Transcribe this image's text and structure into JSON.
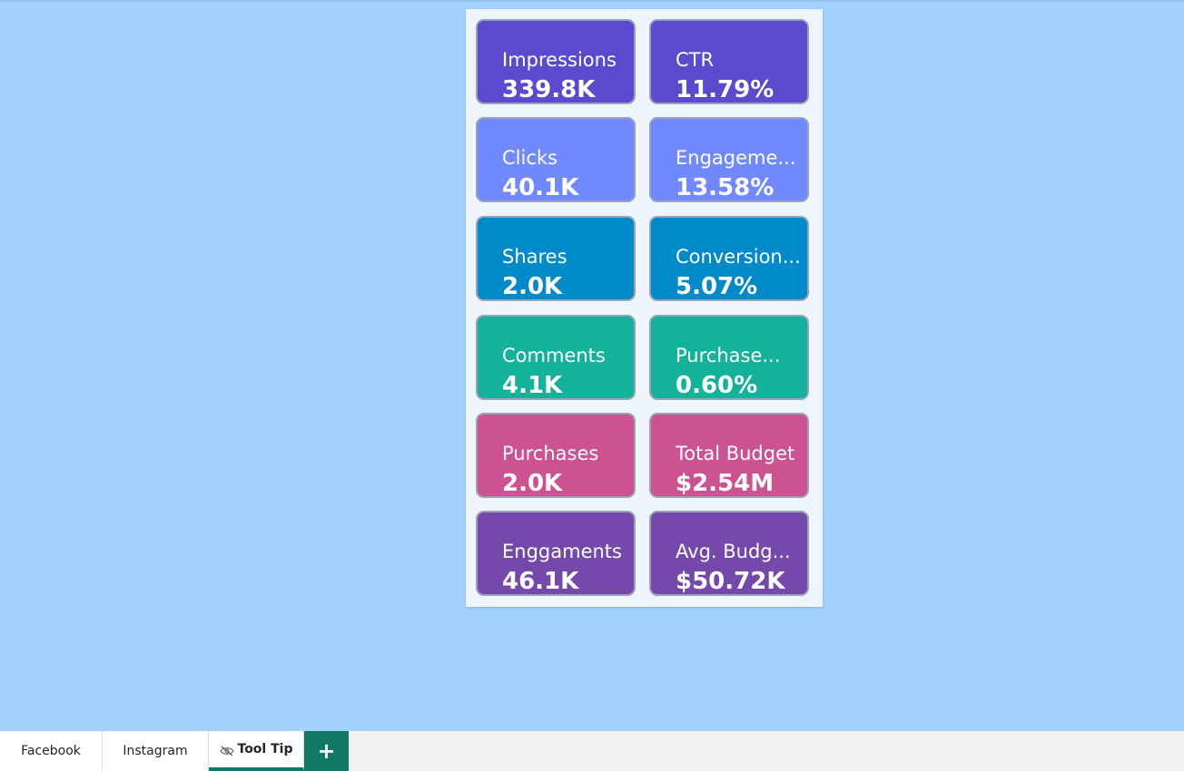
{
  "cards": [
    {
      "label": "Impressions",
      "value": "339.8K",
      "color": "#5a4bce"
    },
    {
      "label": "CTR",
      "value": "11.79%",
      "color": "#5a4bce"
    },
    {
      "label": "Clicks",
      "value": "40.1K",
      "color": "#7089fe"
    },
    {
      "label": "Engageme...",
      "value": "13.58%",
      "color": "#7089fe"
    },
    {
      "label": "Shares",
      "value": "2.0K",
      "color": "#018ac9"
    },
    {
      "label": "Conversion...",
      "value": "5.07%",
      "color": "#018ac9"
    },
    {
      "label": "Comments",
      "value": "4.1K",
      "color": "#13b29b"
    },
    {
      "label": "Purchase...",
      "value": "0.60%",
      "color": "#13b29b"
    },
    {
      "label": "Purchases",
      "value": "2.0K",
      "color": "#cd5291"
    },
    {
      "label": "Total Budget",
      "value": "$2.54M",
      "color": "#cd5291"
    },
    {
      "label": "Enggaments",
      "value": "46.1K",
      "color": "#7449ab"
    },
    {
      "label": "Avg. Budg...",
      "value": "$50.72K",
      "color": "#7449ab"
    }
  ],
  "tabs": [
    {
      "label": "Facebook",
      "active": false
    },
    {
      "label": "Instagram",
      "active": false
    },
    {
      "label": "Tool Tip",
      "active": true,
      "icon": "hidden-eye-icon"
    }
  ],
  "add_tab": {
    "label": "+",
    "icon": "plus-icon"
  },
  "colors": {
    "background": "#a1d1fd",
    "accent": "#117865"
  }
}
